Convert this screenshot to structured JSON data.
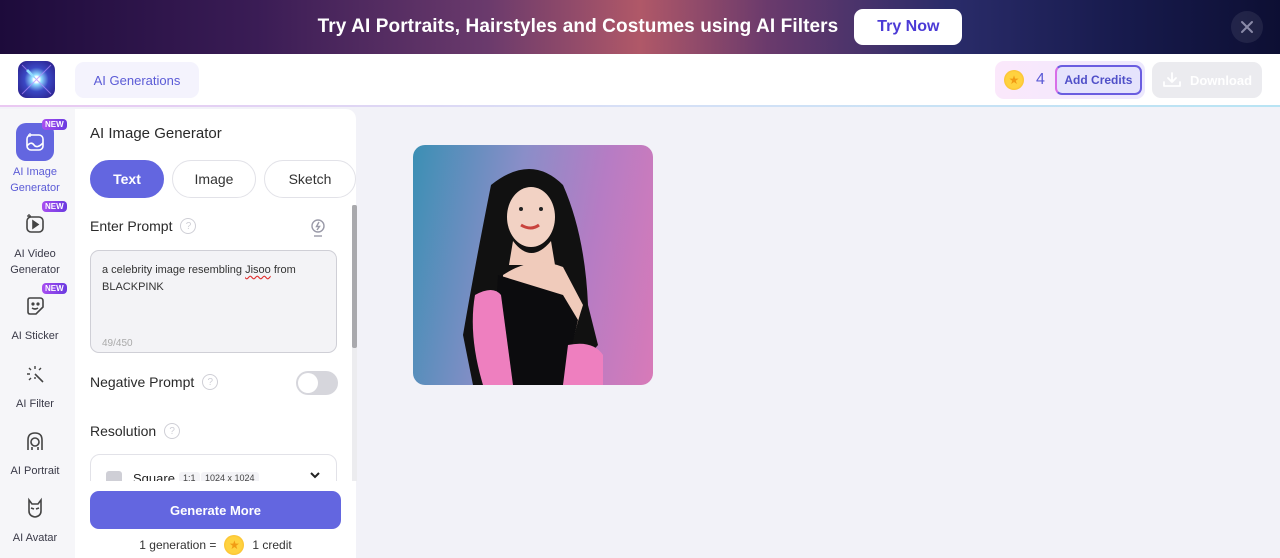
{
  "banner": {
    "text": "Try AI Portraits, Hairstyles and Costumes using AI Filters",
    "cta_label": "Try Now",
    "close_icon": "close-icon"
  },
  "topbar": {
    "logo_icon": "app-logo-icon",
    "tab_label": "AI Generations",
    "credits_count": "4",
    "add_credits_label": "Add Credits",
    "download_label": "Download",
    "accent_color": "#6366e0"
  },
  "leftnav": {
    "items": [
      {
        "label_line1": "AI Image",
        "label_line2": "Generator",
        "icon": "image-sparkle-icon",
        "badge": "NEW",
        "active": true
      },
      {
        "label_line1": "AI Video",
        "label_line2": "Generator",
        "icon": "video-play-icon",
        "badge": "NEW",
        "active": false
      },
      {
        "label_line1": "AI Sticker",
        "label_line2": "",
        "icon": "sticker-icon",
        "badge": "NEW",
        "active": false
      },
      {
        "label_line1": "AI Filter",
        "label_line2": "",
        "icon": "magic-wand-icon",
        "badge": "",
        "active": false
      },
      {
        "label_line1": "AI Portrait",
        "label_line2": "",
        "icon": "portrait-icon",
        "badge": "",
        "active": false
      },
      {
        "label_line1": "AI Avatar",
        "label_line2": "",
        "icon": "avatar-mask-icon",
        "badge": "",
        "active": false
      }
    ]
  },
  "panel": {
    "title": "AI Image Generator",
    "tabs": [
      {
        "label": "Text",
        "active": true
      },
      {
        "label": "Image",
        "active": false
      },
      {
        "label": "Sketch",
        "active": false
      }
    ],
    "prompt": {
      "label": "Enter Prompt",
      "value_before": "a celebrity image resembling ",
      "value_misspelled": "Jisoo",
      "value_after": " from BLACKPINK",
      "char_count": "49/450"
    },
    "negative_prompt": {
      "label": "Negative Prompt",
      "enabled": false
    },
    "resolution": {
      "label": "Resolution",
      "selected_name": "Square",
      "selected_ratio": "1:1",
      "selected_size": "1024 x 1024"
    },
    "generate_label": "Generate More",
    "cost_prefix": "1 generation =",
    "cost_suffix": "1 credit",
    "help_glyph": "?"
  },
  "result": {
    "image_alt": "Generated portrait of a woman with long black hair in a black one-shoulder top with pink sleeves"
  }
}
